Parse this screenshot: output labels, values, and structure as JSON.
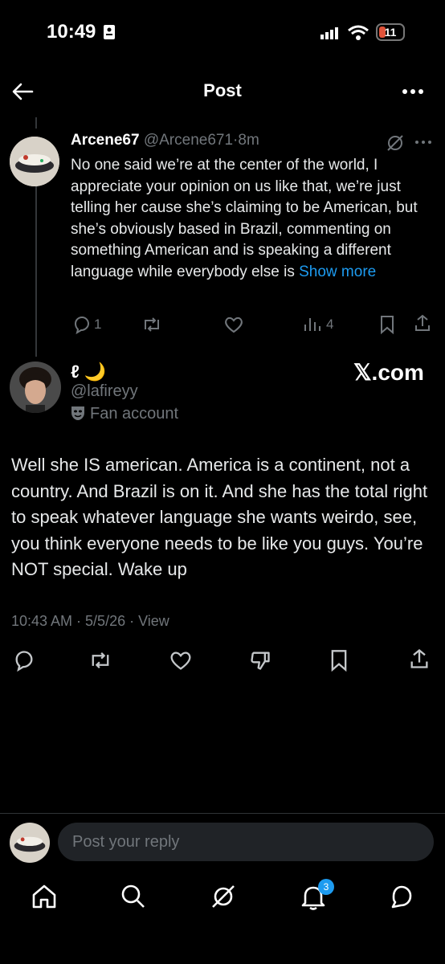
{
  "status_bar": {
    "time": "10:49",
    "battery": "11"
  },
  "header": {
    "title": "Post"
  },
  "parent_post": {
    "display_name": "Arcene67",
    "handle": "@Arcene671",
    "separator": "·",
    "age": "8m",
    "text": "No one said we’re at the center of the world, I appreciate your opinion on us like that, we’re just telling her cause she’s claiming to be American, but she’s obviously based in Brazil, commenting on something American and is speaking a different language while everybody else is ",
    "show_more": "Show more",
    "reply_count": "1",
    "view_count": "4"
  },
  "main_post": {
    "display_name": "ℓ 🌙",
    "handle": "@lafireyy",
    "badge_label": "Fan account",
    "watermark": "𝕏.com",
    "text": "Well she IS american. America is a continent, not a country. And Brazil is on it. And she has the total right to speak whatever language she wants weirdo, see, you think everyone needs to be like you guys. You’re NOT special. Wake up",
    "meta": "10:43 AM · 5/5/26 · View"
  },
  "reply_bar": {
    "placeholder": "Post your reply"
  },
  "bottom_nav": {
    "notifications_badge": "3"
  },
  "colors": {
    "accent": "#1d9bf0",
    "muted": "#71767b",
    "background": "#000000"
  },
  "icons": [
    "back-arrow-icon",
    "more-icon",
    "grok-icon",
    "reply-icon",
    "repost-icon",
    "like-icon",
    "views-icon",
    "bookmark-icon",
    "share-icon",
    "mask-icon",
    "dislike-icon",
    "home-icon",
    "search-icon",
    "bell-icon",
    "messages-icon"
  ]
}
